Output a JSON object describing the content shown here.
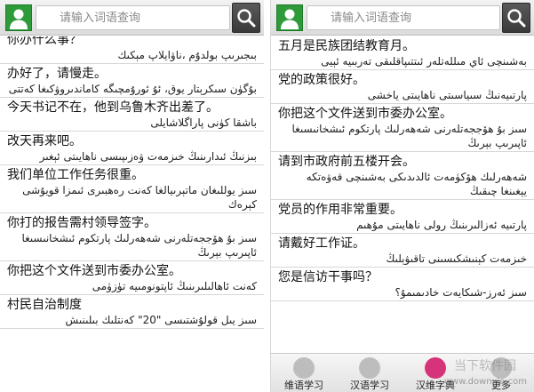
{
  "left": {
    "search_placeholder": "请输入词语查询",
    "entries": [
      {
        "cn": "你办什么事？",
        "ug": "بىجىرىپ بولدۇم ،ناۋايلاپ مېكىك"
      },
      {
        "cn": "办好了，请慢走。",
        "ug": "بۇگۈن سىكرېتار يوق، ئۇ ئورۇمچىگە كاماندىروۋكىغا كەتتى"
      },
      {
        "cn": "今天书记不在，他到乌鲁木齐出差了。",
        "ug": "باشقا كۈنى پاراگلاشايلى"
      },
      {
        "cn": "改天再来吧。",
        "ug": "بىزنىڭ ئىدارىنىڭ خىزمەت ۋەزىپىسى ناھايىتى ئېغىر"
      },
      {
        "cn": "我们单位工作任务很重。",
        "ug": "سىز يوللىغان ماتېرىيالغا كەنت رەھبىرى ئىمزا قويۇشى كېرەك"
      },
      {
        "cn": "你打的报告需村领导签字。",
        "ug": "سىز بۇ ھۆججەتلەرنى شەھەرلىك پارتكوم ئىشخانىسىغا ئاپىرىپ بېرىڭ"
      },
      {
        "cn": "你把这个文件送到市委办公室。",
        "ug": "كەنت ئاھالىلىرىنىڭ ئاپتونومىيە تۈزۈمى"
      },
      {
        "cn": "村民自治制度",
        "ug": "سىز يىل قولۇشتىسى \"20\" كەنتلىك بىلىنىش"
      }
    ]
  },
  "right": {
    "search_placeholder": "请输入词语查询",
    "entries": [
      {
        "cn": "五月是民族团结教育月。",
        "ug": "بەشىنچى ئاي مىللەتلەر ئىتتىپاقلىقى تەربىيە ئېيى"
      },
      {
        "cn": "党的政策很好。",
        "ug": "پارتىيەنىڭ سىياسىتى ناھايىتى ياخشى"
      },
      {
        "cn": "你把这个文件送到市委办公室。",
        "ug": "سىز بۇ ھۆججەتلەرنى شەھەرلىك پارتكوم ئىشخانىسىغا ئاپىرىپ بېرىڭ"
      },
      {
        "cn": "请到市政府前五楼开会。",
        "ug": "شەھەرلىك ھۆكۈمەت ئالدىدىكى بەشىنچى قەۋەتكە يېغىنغا چىقىڭ"
      },
      {
        "cn": "党员的作用非常重要。",
        "ug": "پارتىيە ئەزالىرىنىڭ رولى ناھايىتى مۇھىم"
      },
      {
        "cn": "请戴好工作证。",
        "ug": "خىزمەت كېنىشكىسىنى تاقىۋېلىڭ"
      },
      {
        "cn": "您是信访干事吗？",
        "ug": "سىز ئەرز-شىكايەت خادىمىمۇ؟"
      }
    ],
    "tabs": [
      {
        "label": "维语学习"
      },
      {
        "label": "汉语学习"
      },
      {
        "label": "汉维字典"
      },
      {
        "label": "更多"
      }
    ],
    "watermark_cn": "当下软件园",
    "watermark_url": "www.downxia.com"
  }
}
